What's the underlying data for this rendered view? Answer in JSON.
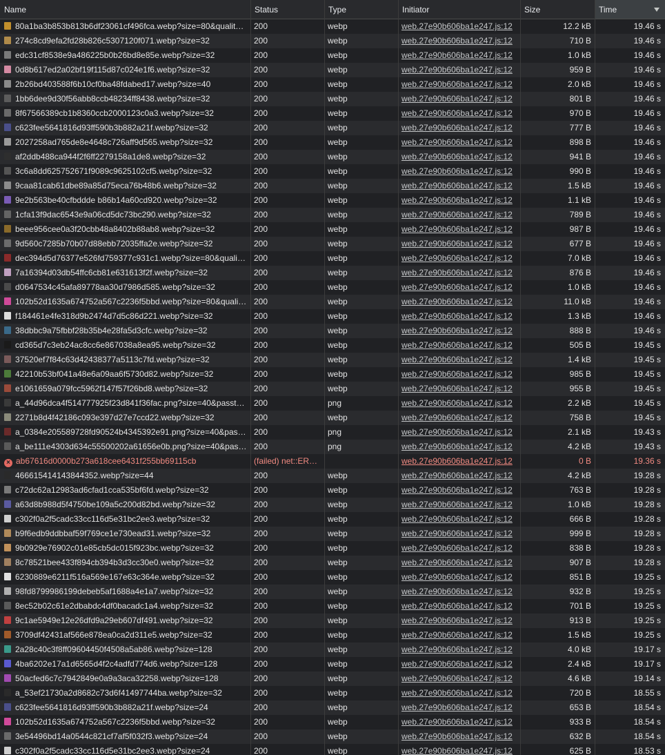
{
  "columns": {
    "name": "Name",
    "status": "Status",
    "type": "Type",
    "initiator": "Initiator",
    "size": "Size",
    "time": "Time"
  },
  "colors": {
    "background": "#202124",
    "header": "#292a2d",
    "failed_text": "#f28b82",
    "icon_palette": [
      "#c28f2c",
      "#8a7a6a",
      "#6e6e6e",
      "#d48aa3",
      "#5c5c5c",
      "#777777",
      "#4a4f8a",
      "#7c7c7c",
      "#555555",
      "#8c6f5c",
      "#7a5bb5",
      "#646464",
      "#8a6a2a",
      "#6c6c6c",
      "#4c7a3a",
      "#b07a9a",
      "#a05a2a",
      "#3a6a8a",
      "#d04a9a",
      "#3a9a8a",
      "#5a5ad0",
      "#2a2a2a"
    ]
  },
  "requests": [
    {
      "name": "80a1ba3b853b813b6df23061cf496fca.webp?size=80&quality=lossless",
      "status": "200",
      "type": "webp",
      "initiator": "web.27e90b606ba1e247.js:12",
      "size": "12.2 kB",
      "time": "19.46 s",
      "icon": "#c28f2c"
    },
    {
      "name": "274c8cd9efa2fd28b826c5307120f071.webp?size=32",
      "status": "200",
      "type": "webp",
      "initiator": "web.27e90b606ba1e247.js:12",
      "size": "710 B",
      "time": "19.46 s",
      "icon": "#b08b4a"
    },
    {
      "name": "edc31cf8538e9a486225b0b26bd8e85e.webp?size=32",
      "status": "200",
      "type": "webp",
      "initiator": "web.27e90b606ba1e247.js:12",
      "size": "1.0 kB",
      "time": "19.46 s",
      "icon": "#7a7a7a"
    },
    {
      "name": "0d8b617ed2a02bf19f115d87c024e1f6.webp?size=32",
      "status": "200",
      "type": "webp",
      "initiator": "web.27e90b606ba1e247.js:12",
      "size": "959 B",
      "time": "19.46 s",
      "icon": "#d48aa3"
    },
    {
      "name": "2b26bd403588f6b10cf0ba48fdabed17.webp?size=40",
      "status": "200",
      "type": "webp",
      "initiator": "web.27e90b606ba1e247.js:12",
      "size": "2.0 kB",
      "time": "19.46 s",
      "icon": "#8a8a8a"
    },
    {
      "name": "1bb6dee9d30f56abb8ccb48234ff8438.webp?size=32",
      "status": "200",
      "type": "webp",
      "initiator": "web.27e90b606ba1e247.js:12",
      "size": "801 B",
      "time": "19.46 s",
      "icon": "#5c5c5c"
    },
    {
      "name": "8f67566389cb1b8360ccb2000123c0a3.webp?size=32",
      "status": "200",
      "type": "webp",
      "initiator": "web.27e90b606ba1e247.js:12",
      "size": "970 B",
      "time": "19.46 s",
      "icon": "#6a6a6a"
    },
    {
      "name": "c623fee5641816d93ff590b3b882a21f.webp?size=32",
      "status": "200",
      "type": "webp",
      "initiator": "web.27e90b606ba1e247.js:12",
      "size": "777 B",
      "time": "19.46 s",
      "icon": "#4a4f8a"
    },
    {
      "name": "2027258ad765de8e4648c726aff9d565.webp?size=32",
      "status": "200",
      "type": "webp",
      "initiator": "web.27e90b606ba1e247.js:12",
      "size": "898 B",
      "time": "19.46 s",
      "icon": "#9a9a9a"
    },
    {
      "name": "af2ddb488ca944f2f6ff2279158a1de8.webp?size=32",
      "status": "200",
      "type": "webp",
      "initiator": "web.27e90b606ba1e247.js:12",
      "size": "941 B",
      "time": "19.46 s",
      "icon": "#2e2e2e"
    },
    {
      "name": "3c6a8dd625752671f9089c9625102cf5.webp?size=32",
      "status": "200",
      "type": "webp",
      "initiator": "web.27e90b606ba1e247.js:12",
      "size": "990 B",
      "time": "19.46 s",
      "icon": "#555555"
    },
    {
      "name": "9caa81cab61dbe89a85d75eca76b48b6.webp?size=32",
      "status": "200",
      "type": "webp",
      "initiator": "web.27e90b606ba1e247.js:12",
      "size": "1.5 kB",
      "time": "19.46 s",
      "icon": "#8c8c8c"
    },
    {
      "name": "9e2b563be40cfbddde b86b14a60cd920.webp?size=32",
      "status": "200",
      "type": "webp",
      "initiator": "web.27e90b606ba1e247.js:12",
      "size": "1.1 kB",
      "time": "19.46 s",
      "icon": "#7a5bb5"
    },
    {
      "name": "1cfa13f9dac6543e9a06cd5dc73bc290.webp?size=32",
      "status": "200",
      "type": "webp",
      "initiator": "web.27e90b606ba1e247.js:12",
      "size": "789 B",
      "time": "19.46 s",
      "icon": "#646464"
    },
    {
      "name": "beee956cee0a3f20cbb48a8402b88ab8.webp?size=32",
      "status": "200",
      "type": "webp",
      "initiator": "web.27e90b606ba1e247.js:12",
      "size": "987 B",
      "time": "19.46 s",
      "icon": "#8a6a2a"
    },
    {
      "name": "9d560c7285b70b07d88ebb72035ffa2e.webp?size=32",
      "status": "200",
      "type": "webp",
      "initiator": "web.27e90b606ba1e247.js:12",
      "size": "677 B",
      "time": "19.46 s",
      "icon": "#6c6c6c"
    },
    {
      "name": "dec394d5d76377e526fd759377c931c1.webp?size=80&quality=lossless",
      "status": "200",
      "type": "webp",
      "initiator": "web.27e90b606ba1e247.js:12",
      "size": "7.0 kB",
      "time": "19.46 s",
      "icon": "#8a2a2a"
    },
    {
      "name": "7a16394d03db54ffc6cb81e631613f2f.webp?size=32",
      "status": "200",
      "type": "webp",
      "initiator": "web.27e90b606ba1e247.js:12",
      "size": "876 B",
      "time": "19.46 s",
      "icon": "#c0a0c0"
    },
    {
      "name": "d0647534c45afa89778aa30d7986d585.webp?size=32",
      "status": "200",
      "type": "webp",
      "initiator": "web.27e90b606ba1e247.js:12",
      "size": "1.0 kB",
      "time": "19.46 s",
      "icon": "#4a4a4a"
    },
    {
      "name": "102b52d1635a674752a567c2236f5bbd.webp?size=80&quality=lossless",
      "status": "200",
      "type": "webp",
      "initiator": "web.27e90b606ba1e247.js:12",
      "size": "11.0 kB",
      "time": "19.46 s",
      "icon": "#d04a9a"
    },
    {
      "name": "f184461e4fe318d9b2474d7d5c86d221.webp?size=32",
      "status": "200",
      "type": "webp",
      "initiator": "web.27e90b606ba1e247.js:12",
      "size": "1.3 kB",
      "time": "19.46 s",
      "icon": "#dcdcdc"
    },
    {
      "name": "38dbbc9a75fbbf28b35b4e28fa5d3cfc.webp?size=32",
      "status": "200",
      "type": "webp",
      "initiator": "web.27e90b606ba1e247.js:12",
      "size": "888 B",
      "time": "19.46 s",
      "icon": "#3a6a8a"
    },
    {
      "name": "cd365d7c3eb24ac8cc6e867038a8ea95.webp?size=32",
      "status": "200",
      "type": "webp",
      "initiator": "web.27e90b606ba1e247.js:12",
      "size": "505 B",
      "time": "19.45 s",
      "icon": "#1a1a1a"
    },
    {
      "name": "37520ef7f84c63d42438377a5113c7fd.webp?size=32",
      "status": "200",
      "type": "webp",
      "initiator": "web.27e90b606ba1e247.js:12",
      "size": "1.4 kB",
      "time": "19.45 s",
      "icon": "#7a5a5a"
    },
    {
      "name": "42210b53bf041a48e6a09aa6f5730d82.webp?size=32",
      "status": "200",
      "type": "webp",
      "initiator": "web.27e90b606ba1e247.js:12",
      "size": "985 B",
      "time": "19.45 s",
      "icon": "#4c7a3a"
    },
    {
      "name": "e1061659a079fcc5962f147f57f26bd8.webp?size=32",
      "status": "200",
      "type": "webp",
      "initiator": "web.27e90b606ba1e247.js:12",
      "size": "955 B",
      "time": "19.45 s",
      "icon": "#9a4a3a"
    },
    {
      "name": "a_44d96dca4f514777925f23d841f36fac.png?size=40&passthrough=false",
      "status": "200",
      "type": "png",
      "initiator": "web.27e90b606ba1e247.js:12",
      "size": "2.2 kB",
      "time": "19.45 s",
      "icon": "#3a3a3a"
    },
    {
      "name": "2271b8d4f42186c093e397d27e7ccd22.webp?size=32",
      "status": "200",
      "type": "webp",
      "initiator": "web.27e90b606ba1e247.js:12",
      "size": "758 B",
      "time": "19.45 s",
      "icon": "#8a8a7a"
    },
    {
      "name": "a_0384e205589728fd90524b4345392e91.png?size=40&passthrough=false",
      "status": "200",
      "type": "png",
      "initiator": "web.27e90b606ba1e247.js:12",
      "size": "2.1 kB",
      "time": "19.43 s",
      "icon": "#6a2a2a"
    },
    {
      "name": "a_be111e4303d634c55500202a61656e0b.png?size=40&passthrough=false",
      "status": "200",
      "type": "png",
      "initiator": "web.27e90b606ba1e247.js:12",
      "size": "4.2 kB",
      "time": "19.43 s",
      "icon": "#5a5a5a"
    },
    {
      "name": "ab67616d0000b273a618cee6431f255bb69115cb",
      "status": "(failed) net::ERR_BLOCKED_BY_CLIENT",
      "type": "",
      "initiator": "web.27e90b606ba1e247.js:12",
      "size": "0 B",
      "time": "19.36 s",
      "failed": true
    },
    {
      "name": "466615414143844352.webp?size=44",
      "status": "200",
      "type": "webp",
      "initiator": "web.27e90b606ba1e247.js:12",
      "size": "4.2 kB",
      "time": "19.28 s",
      "icon": "#2a2a2a"
    },
    {
      "name": "c72dc62a12983ad6cfad1cca535bf6fd.webp?size=32",
      "status": "200",
      "type": "webp",
      "initiator": "web.27e90b606ba1e247.js:12",
      "size": "763 B",
      "time": "19.28 s",
      "icon": "#7a7a7a"
    },
    {
      "name": "a63d8b988d5f4750be109a5c200d82bd.webp?size=32",
      "status": "200",
      "type": "webp",
      "initiator": "web.27e90b606ba1e247.js:12",
      "size": "1.0 kB",
      "time": "19.28 s",
      "icon": "#5a5aa0"
    },
    {
      "name": "c302f0a2f5cadc33cc116d5e31bc2ee3.webp?size=32",
      "status": "200",
      "type": "webp",
      "initiator": "web.27e90b606ba1e247.js:12",
      "size": "666 B",
      "time": "19.28 s",
      "icon": "#cfcfcf"
    },
    {
      "name": "b9f6edb9ddbbaf59f769ce1e730ead31.webp?size=32",
      "status": "200",
      "type": "webp",
      "initiator": "web.27e90b606ba1e247.js:12",
      "size": "999 B",
      "time": "19.28 s",
      "icon": "#b08a5a"
    },
    {
      "name": "9b0929e76902c01e85cb5dc015f923bc.webp?size=32",
      "status": "200",
      "type": "webp",
      "initiator": "web.27e90b606ba1e247.js:12",
      "size": "838 B",
      "time": "19.28 s",
      "icon": "#c0905a"
    },
    {
      "name": "8c78521bee433f894cb394b3d3cc30e0.webp?size=32",
      "status": "200",
      "type": "webp",
      "initiator": "web.27e90b606ba1e247.js:12",
      "size": "907 B",
      "time": "19.28 s",
      "icon": "#a08060"
    },
    {
      "name": "6230889e6211f516a569e167e63c364e.webp?size=32",
      "status": "200",
      "type": "webp",
      "initiator": "web.27e90b606ba1e247.js:12",
      "size": "851 B",
      "time": "19.25 s",
      "icon": "#e0e0e0"
    },
    {
      "name": "98fd8799986199debeb5af1688a4e1a7.webp?size=32",
      "status": "200",
      "type": "webp",
      "initiator": "web.27e90b606ba1e247.js:12",
      "size": "932 B",
      "time": "19.25 s",
      "icon": "#b0b0b0"
    },
    {
      "name": "8ec52b02c61e2dbabdc4df0bacadc1a4.webp?size=32",
      "status": "200",
      "type": "webp",
      "initiator": "web.27e90b606ba1e247.js:12",
      "size": "701 B",
      "time": "19.25 s",
      "icon": "#5a5a5a"
    },
    {
      "name": "9c1ae5949e12e26dfd9a29eb607df491.webp?size=32",
      "status": "200",
      "type": "webp",
      "initiator": "web.27e90b606ba1e247.js:12",
      "size": "913 B",
      "time": "19.25 s",
      "icon": "#c04040"
    },
    {
      "name": "3709df42431af566e878ea0ca2d311e5.webp?size=32",
      "status": "200",
      "type": "webp",
      "initiator": "web.27e90b606ba1e247.js:12",
      "size": "1.5 kB",
      "time": "19.25 s",
      "icon": "#a05a2a"
    },
    {
      "name": "2a28c40c3f8ff09604450f4508a5ab86.webp?size=128",
      "status": "200",
      "type": "webp",
      "initiator": "web.27e90b606ba1e247.js:12",
      "size": "4.0 kB",
      "time": "19.17 s",
      "icon": "#3a9a8a"
    },
    {
      "name": "4ba6202e17a1d6565d4f2c4adfd774d6.webp?size=128",
      "status": "200",
      "type": "webp",
      "initiator": "web.27e90b606ba1e247.js:12",
      "size": "2.4 kB",
      "time": "19.17 s",
      "icon": "#5a5ad0"
    },
    {
      "name": "50acfed6c7c7942849e0a9a3aca32258.webp?size=128",
      "status": "200",
      "type": "webp",
      "initiator": "web.27e90b606ba1e247.js:12",
      "size": "4.6 kB",
      "time": "19.14 s",
      "icon": "#a04ab0"
    },
    {
      "name": "a_53ef21730a2d8682c73d6f41497744ba.webp?size=32",
      "status": "200",
      "type": "webp",
      "initiator": "web.27e90b606ba1e247.js:12",
      "size": "720 B",
      "time": "18.55 s",
      "icon": "#2a2a2a"
    },
    {
      "name": "c623fee5641816d93ff590b3b882a21f.webp?size=24",
      "status": "200",
      "type": "webp",
      "initiator": "web.27e90b606ba1e247.js:12",
      "size": "653 B",
      "time": "18.54 s",
      "icon": "#4a4f8a"
    },
    {
      "name": "102b52d1635a674752a567c2236f5bbd.webp?size=32",
      "status": "200",
      "type": "webp",
      "initiator": "web.27e90b606ba1e247.js:12",
      "size": "933 B",
      "time": "18.54 s",
      "icon": "#d04a9a"
    },
    {
      "name": "3e54496bd14a0544c821cf7af5f032f3.webp?size=24",
      "status": "200",
      "type": "webp",
      "initiator": "web.27e90b606ba1e247.js:12",
      "size": "632 B",
      "time": "18.54 s",
      "icon": "#6a6a6a"
    },
    {
      "name": "c302f0a2f5cadc33cc116d5e31bc2ee3.webp?size=24",
      "status": "200",
      "type": "webp",
      "initiator": "web.27e90b606ba1e247.js:12",
      "size": "625 B",
      "time": "18.53 s",
      "icon": "#cfcfcf"
    }
  ]
}
